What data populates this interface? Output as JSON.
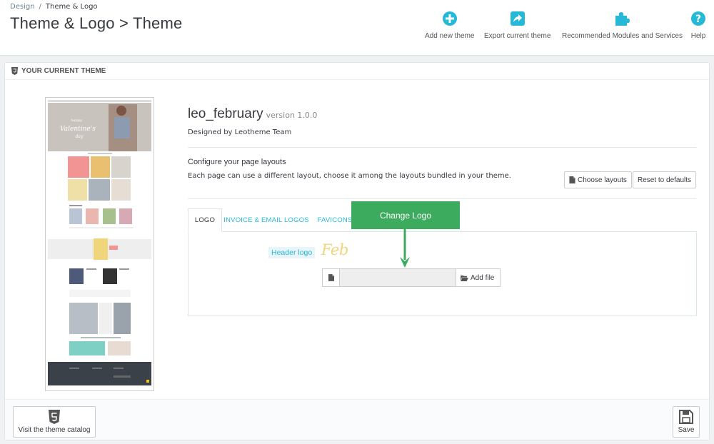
{
  "breadcrumb": {
    "parent": "Design",
    "separator": "/",
    "current": "Theme & Logo"
  },
  "page_title": "Theme & Logo > Theme",
  "toolbar": [
    {
      "label": "Add new theme",
      "icon": "plus-circle-icon"
    },
    {
      "label": "Export current theme",
      "icon": "share-icon"
    },
    {
      "label": "Recommended Modules and Services",
      "icon": "puzzle-icon"
    },
    {
      "label": "Help",
      "icon": "question-circle-icon"
    }
  ],
  "accent_color": "#25b9d7",
  "callout_color": "#3cab5e",
  "panel": {
    "heading": "YOUR CURRENT THEME",
    "heading_icon": "html5-icon",
    "theme_name": "leo_february",
    "theme_version": "version 1.0.0",
    "designed_by": "Designed by Leotheme Team",
    "configure_title": "Configure your page layouts",
    "configure_desc": "Each page can use a different layout, choose it among the layouts bundled in your theme.",
    "choose_layouts": "Choose layouts",
    "reset_defaults": "Reset to defaults",
    "preview_banner": [
      "happy",
      "Valentine's",
      "day"
    ]
  },
  "tabs": [
    {
      "label": "LOGO",
      "active": true
    },
    {
      "label": "INVOICE & EMAIL LOGOS",
      "active": false
    },
    {
      "label": "FAVICONS",
      "active": false
    }
  ],
  "logo_tab": {
    "header_logo_label": "Header logo",
    "logo_preview_text": "Feb",
    "file_value": "",
    "add_file": "Add file"
  },
  "callout": "Change Logo",
  "footer": {
    "catalog_button": "Visit the theme catalog",
    "save_button": "Save"
  }
}
